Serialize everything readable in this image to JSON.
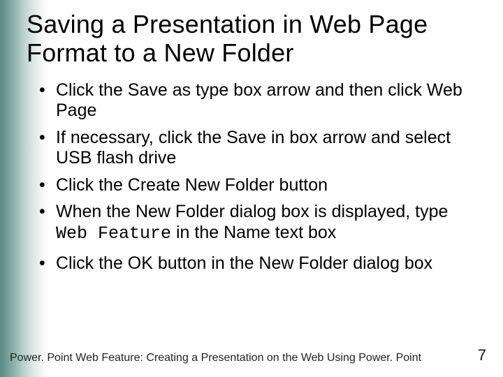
{
  "title": "Saving a Presentation in Web Page Format to a New Folder",
  "bullets_group1": [
    "Click the Save as type box arrow and then click Web Page",
    "If necessary, click the Save in box arrow and select USB flash drive",
    "Click the Create New Folder button"
  ],
  "bullet4_prefix": "When the New Folder dialog box is displayed, type ",
  "bullet4_mono": "Web Feature",
  "bullet4_suffix": " in the Name text box",
  "bullets_group2": [
    "Click the OK button in the New Folder dialog box"
  ],
  "footer": "Power. Point Web Feature: Creating a Presentation on the Web Using Power. Point",
  "page_number": "7"
}
